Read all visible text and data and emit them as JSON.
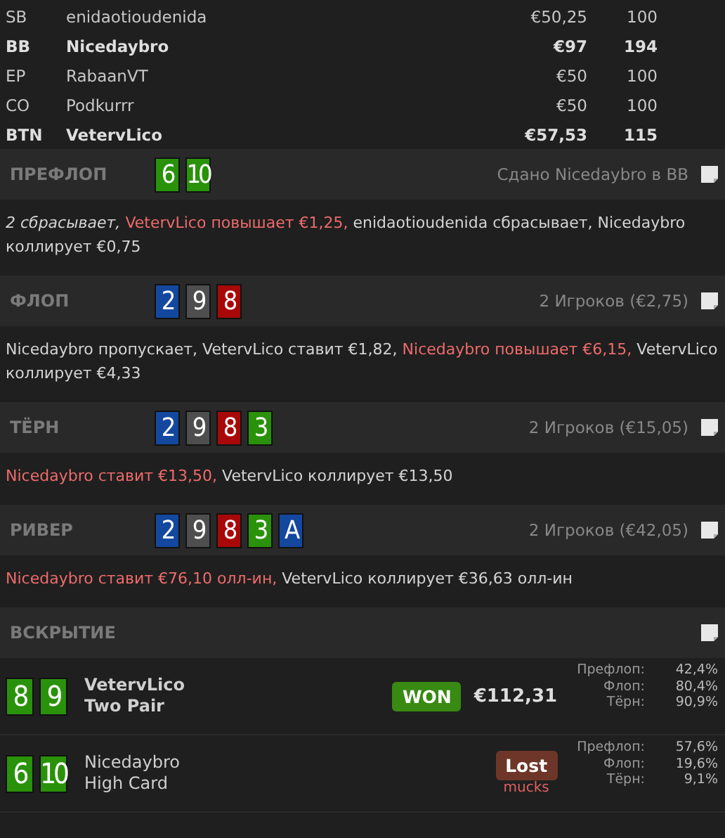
{
  "players": [
    {
      "position": "SB",
      "name": "enidaotioudenida",
      "stack": "€50,25",
      "bb": "100",
      "highlighted": false
    },
    {
      "position": "BB",
      "name": "Nicedaybro",
      "stack": "€97",
      "bb": "194",
      "highlighted": true
    },
    {
      "position": "EP",
      "name": "RabaanVT",
      "stack": "€50",
      "bb": "100",
      "highlighted": false
    },
    {
      "position": "CO",
      "name": "Podkurrr",
      "stack": "€50",
      "bb": "100",
      "highlighted": false
    },
    {
      "position": "BTN",
      "name": "VetervLico",
      "stack": "€57,53",
      "bb": "115",
      "highlighted": true
    }
  ],
  "streets": [
    {
      "name": "ПРЕФЛОП",
      "cards": [
        {
          "rank": "6",
          "color": "#2a920a"
        },
        {
          "rank": "10",
          "color": "#2a920a"
        }
      ],
      "info": "Сдано Nicedaybro в BB",
      "actions": [
        {
          "text": "2 сбрасывает,",
          "kind": "summary"
        },
        {
          "text": "VetervLico повышает €1,25,",
          "kind": "aggressive"
        },
        {
          "text": "enidaotioudenida сбрасывает,",
          "kind": "normal"
        },
        {
          "text": "Nicedaybro коллирует €0,75",
          "kind": "normal"
        }
      ]
    },
    {
      "name": "ФЛОП",
      "cards": [
        {
          "rank": "2",
          "color": "#14479e"
        },
        {
          "rank": "9",
          "color": "#4e4e4e"
        },
        {
          "rank": "8",
          "color": "#a80808"
        }
      ],
      "info": "2 Игроков (€2,75)",
      "actions": [
        {
          "text": "Nicedaybro пропускает,",
          "kind": "normal"
        },
        {
          "text": "VetervLico ставит €1,82,",
          "kind": "normal"
        },
        {
          "text": "Nicedaybro повышает €6,15,",
          "kind": "aggressive"
        },
        {
          "text": "VetervLico коллирует €4,33",
          "kind": "normal"
        }
      ]
    },
    {
      "name": "ТЁРН",
      "cards": [
        {
          "rank": "2",
          "color": "#14479e"
        },
        {
          "rank": "9",
          "color": "#4e4e4e"
        },
        {
          "rank": "8",
          "color": "#a80808"
        },
        {
          "rank": "3",
          "color": "#2a920a"
        }
      ],
      "info": "2 Игроков (€15,05)",
      "actions": [
        {
          "text": "Nicedaybro ставит €13,50,",
          "kind": "aggressive"
        },
        {
          "text": "VetervLico коллирует €13,50",
          "kind": "normal"
        }
      ]
    },
    {
      "name": "РИВЕР",
      "cards": [
        {
          "rank": "2",
          "color": "#14479e"
        },
        {
          "rank": "9",
          "color": "#4e4e4e"
        },
        {
          "rank": "8",
          "color": "#a80808"
        },
        {
          "rank": "3",
          "color": "#2a920a"
        },
        {
          "rank": "A",
          "color": "#14479e"
        }
      ],
      "info": "2 Игроков (€42,05)",
      "actions": [
        {
          "text": "Nicedaybro ставит €76,10 олл-ин,",
          "kind": "aggressive"
        },
        {
          "text": "VetervLico коллирует €36,63 олл-ин",
          "kind": "normal"
        }
      ]
    }
  ],
  "showdown": {
    "title": "ВСКРЫТИЕ",
    "players": [
      {
        "cards": [
          {
            "rank": "8",
            "color": "#2a920a"
          },
          {
            "rank": "9",
            "color": "#2a920a"
          }
        ],
        "name": "VetervLico",
        "hand": "Two Pair",
        "result": {
          "kind": "won",
          "label": "WON",
          "amount": "€112,31"
        },
        "equity": [
          {
            "label": "Префлоп:",
            "value": "42,4%"
          },
          {
            "label": "Флоп:",
            "value": "80,4%"
          },
          {
            "label": "Тёрн:",
            "value": "90,9%"
          }
        ]
      },
      {
        "cards": [
          {
            "rank": "6",
            "color": "#2a920a"
          },
          {
            "rank": "10",
            "color": "#2a920a"
          }
        ],
        "name": "Nicedaybro",
        "hand": "High Card",
        "result": {
          "kind": "lost",
          "label": "Lost",
          "note": "mucks"
        },
        "equity": [
          {
            "label": "Префлоп:",
            "value": "57,6%"
          },
          {
            "label": "Флоп:",
            "value": "19,6%"
          },
          {
            "label": "Тёрн:",
            "value": "9,1%"
          }
        ]
      }
    ]
  }
}
